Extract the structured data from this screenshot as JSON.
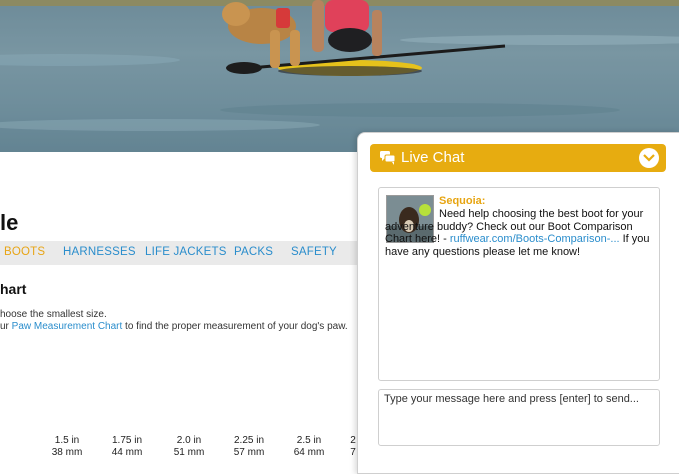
{
  "hero": {
    "alt_subject": "dog-on-paddleboard-photo"
  },
  "page": {
    "title_fragment": "le",
    "nav": [
      {
        "label": "BOOTS",
        "active": true
      },
      {
        "label": "HARNESSES",
        "active": false
      },
      {
        "label": "LIFE JACKETS",
        "active": false
      },
      {
        "label": "PACKS",
        "active": false
      },
      {
        "label": "SAFETY",
        "active": false
      }
    ],
    "section_title": "hart",
    "line1": "hoose the smallest size.",
    "line2_prefix": "ur ",
    "line2_link": "Paw Measurement Chart",
    "line2_suffix": " to find the proper measurement of your dog's paw.",
    "sizes": [
      {
        "in": "1.5 in",
        "mm": "38 mm"
      },
      {
        "in": "1.75 in",
        "mm": "44 mm"
      },
      {
        "in": "2.0 in",
        "mm": "51 mm"
      },
      {
        "in": "2.25 in",
        "mm": "57 mm"
      },
      {
        "in": "2.5 in",
        "mm": "64 mm"
      },
      {
        "in": "2",
        "mm": "7"
      }
    ]
  },
  "chat": {
    "title": "Live Chat",
    "author": "Sequoia:",
    "message_text": "Need help choosing the best boot for your adventure buddy? Check out our Boot Comparison Chart here! - ",
    "message_link": "ruffwear.com/Boots-Comparison-...",
    "message_after": " If you have any questions please let me know!",
    "input_placeholder": "Type your message here and press [enter] to send...",
    "colors": {
      "header": "#e7ac10",
      "author": "#e7a512",
      "link": "#2a8dcc"
    }
  }
}
